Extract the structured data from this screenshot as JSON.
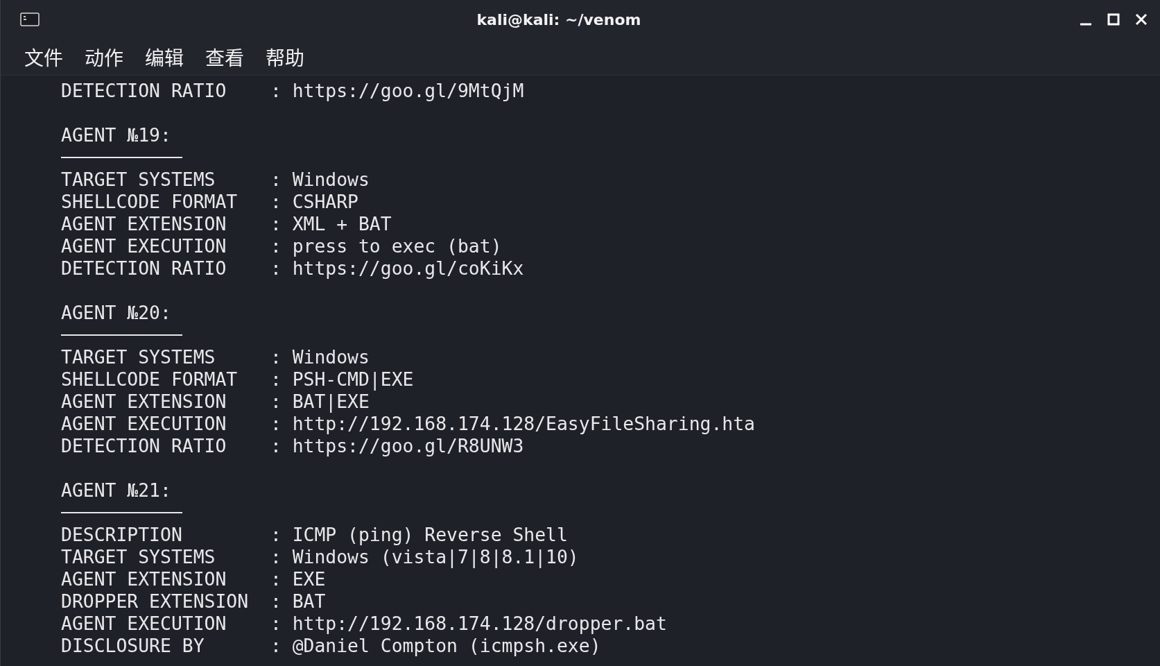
{
  "window": {
    "title": "kali@kali: ~/venom"
  },
  "menu": [
    "文件",
    "动作",
    "编辑",
    "查看",
    "帮助"
  ],
  "terminal": {
    "blocks": [
      {
        "fields": [
          {
            "label": "DETECTION RATIO",
            "separator": ":",
            "value": "https://goo.gl/9MtQjM"
          }
        ]
      },
      {
        "heading": "AGENT №19:",
        "fields": [
          {
            "label": "TARGET SYSTEMS",
            "separator": ":",
            "value": "Windows"
          },
          {
            "label": "SHELLCODE FORMAT",
            "separator": ":",
            "value": "CSHARP"
          },
          {
            "label": "AGENT EXTENSION",
            "separator": ":",
            "value": "XML + BAT"
          },
          {
            "label": "AGENT EXECUTION",
            "separator": ":",
            "value": "press to exec (bat)"
          },
          {
            "label": "DETECTION RATIO",
            "separator": ":",
            "value": "https://goo.gl/coKiKx"
          }
        ]
      },
      {
        "heading": "AGENT №20:",
        "fields": [
          {
            "label": "TARGET SYSTEMS",
            "separator": ":",
            "value": "Windows"
          },
          {
            "label": "SHELLCODE FORMAT",
            "separator": ":",
            "value": "PSH-CMD|EXE"
          },
          {
            "label": "AGENT EXTENSION",
            "separator": ":",
            "value": "BAT|EXE"
          },
          {
            "label": "AGENT EXECUTION",
            "separator": ":",
            "value": "http://192.168.174.128/EasyFileSharing.hta"
          },
          {
            "label": "DETECTION RATIO",
            "separator": ":",
            "value": "https://goo.gl/R8UNW3"
          }
        ]
      },
      {
        "heading": "AGENT №21:",
        "fields": [
          {
            "label": "DESCRIPTION",
            "separator": ":",
            "value": "ICMP (ping) Reverse Shell"
          },
          {
            "label": "TARGET SYSTEMS",
            "separator": ":",
            "value": "Windows (vista|7|8|8.1|10)"
          },
          {
            "label": "AGENT EXTENSION",
            "separator": ":",
            "value": "EXE"
          },
          {
            "label": "DROPPER EXTENSION",
            "separator": ":",
            "value": "BAT"
          },
          {
            "label": "AGENT EXECUTION",
            "separator": ":",
            "value": "http://192.168.174.128/dropper.bat"
          },
          {
            "label": "DISCLOSURE BY",
            "separator": ":",
            "value": "@Daniel Compton (icmpsh.exe)"
          }
        ]
      }
    ]
  }
}
